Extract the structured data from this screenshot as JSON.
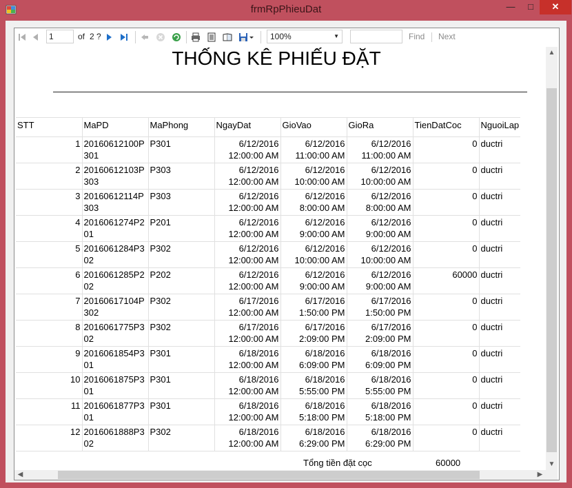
{
  "window": {
    "title": "frmRpPhieuDat",
    "minimize": "—",
    "maximize": "□",
    "close": "✕"
  },
  "toolbar": {
    "page": "1",
    "of_label": "of",
    "total_pages": "2 ?",
    "zoom": "100%",
    "find": "Find",
    "next": "Next"
  },
  "report": {
    "title": "THỐNG KÊ PHIẾU ĐẶT",
    "columns": [
      "STT",
      "MaPD",
      "MaPhong",
      "NgayDat",
      "GioVao",
      "GioRa",
      "TienDatCoc",
      "NguoiLap"
    ],
    "rows": [
      {
        "stt": "1",
        "mapd": "20160612100P301",
        "maphong": "P301",
        "ngaydat": "6/12/2016 12:00:00 AM",
        "giovao": "6/12/2016 11:00:00 AM",
        "giora": "6/12/2016 11:00:00 AM",
        "tien": "0",
        "nguoilap": "ductri"
      },
      {
        "stt": "2",
        "mapd": "20160612103P303",
        "maphong": "P303",
        "ngaydat": "6/12/2016 12:00:00 AM",
        "giovao": "6/12/2016 10:00:00 AM",
        "giora": "6/12/2016 10:00:00 AM",
        "tien": "0",
        "nguoilap": "ductri"
      },
      {
        "stt": "3",
        "mapd": "20160612114P303",
        "maphong": "P303",
        "ngaydat": "6/12/2016 12:00:00 AM",
        "giovao": "6/12/2016 8:00:00 AM",
        "giora": "6/12/2016 8:00:00 AM",
        "tien": "0",
        "nguoilap": "ductri"
      },
      {
        "stt": "4",
        "mapd": "2016061274P201",
        "maphong": "P201",
        "ngaydat": "6/12/2016 12:00:00 AM",
        "giovao": "6/12/2016 9:00:00 AM",
        "giora": "6/12/2016 9:00:00 AM",
        "tien": "0",
        "nguoilap": "ductri"
      },
      {
        "stt": "5",
        "mapd": "2016061284P302",
        "maphong": "P302",
        "ngaydat": "6/12/2016 12:00:00 AM",
        "giovao": "6/12/2016 10:00:00 AM",
        "giora": "6/12/2016 10:00:00 AM",
        "tien": "0",
        "nguoilap": "ductri"
      },
      {
        "stt": "6",
        "mapd": "2016061285P202",
        "maphong": "P202",
        "ngaydat": "6/12/2016 12:00:00 AM",
        "giovao": "6/12/2016 9:00:00 AM",
        "giora": "6/12/2016 9:00:00 AM",
        "tien": "60000",
        "nguoilap": "ductri"
      },
      {
        "stt": "7",
        "mapd": "20160617104P302",
        "maphong": "P302",
        "ngaydat": "6/17/2016 12:00:00 AM",
        "giovao": "6/17/2016 1:50:00 PM",
        "giora": "6/17/2016 1:50:00 PM",
        "tien": "0",
        "nguoilap": "ductri"
      },
      {
        "stt": "8",
        "mapd": "2016061775P302",
        "maphong": "P302",
        "ngaydat": "6/17/2016 12:00:00 AM",
        "giovao": "6/17/2016 2:09:00 PM",
        "giora": "6/17/2016 2:09:00 PM",
        "tien": "0",
        "nguoilap": "ductri"
      },
      {
        "stt": "9",
        "mapd": "2016061854P301",
        "maphong": "P301",
        "ngaydat": "6/18/2016 12:00:00 AM",
        "giovao": "6/18/2016 6:09:00 PM",
        "giora": "6/18/2016 6:09:00 PM",
        "tien": "0",
        "nguoilap": "ductri"
      },
      {
        "stt": "10",
        "mapd": "2016061875P301",
        "maphong": "P301",
        "ngaydat": "6/18/2016 12:00:00 AM",
        "giovao": "6/18/2016 5:55:00 PM",
        "giora": "6/18/2016 5:55:00 PM",
        "tien": "0",
        "nguoilap": "ductri"
      },
      {
        "stt": "11",
        "mapd": "2016061877P301",
        "maphong": "P301",
        "ngaydat": "6/18/2016 12:00:00 AM",
        "giovao": "6/18/2016 5:18:00 PM",
        "giora": "6/18/2016 5:18:00 PM",
        "tien": "0",
        "nguoilap": "ductri"
      },
      {
        "stt": "12",
        "mapd": "2016061888P302",
        "maphong": "P302",
        "ngaydat": "6/18/2016 12:00:00 AM",
        "giovao": "6/18/2016 6:29:00 PM",
        "giora": "6/18/2016 6:29:00 PM",
        "tien": "0",
        "nguoilap": "ductri"
      }
    ],
    "total_label": "Tổng tiền đặt cọc",
    "total_value": "60000"
  },
  "colors": {
    "titlebar": "#c0505e",
    "close": "#c7302a",
    "nav_blue": "#1e6fc9"
  }
}
